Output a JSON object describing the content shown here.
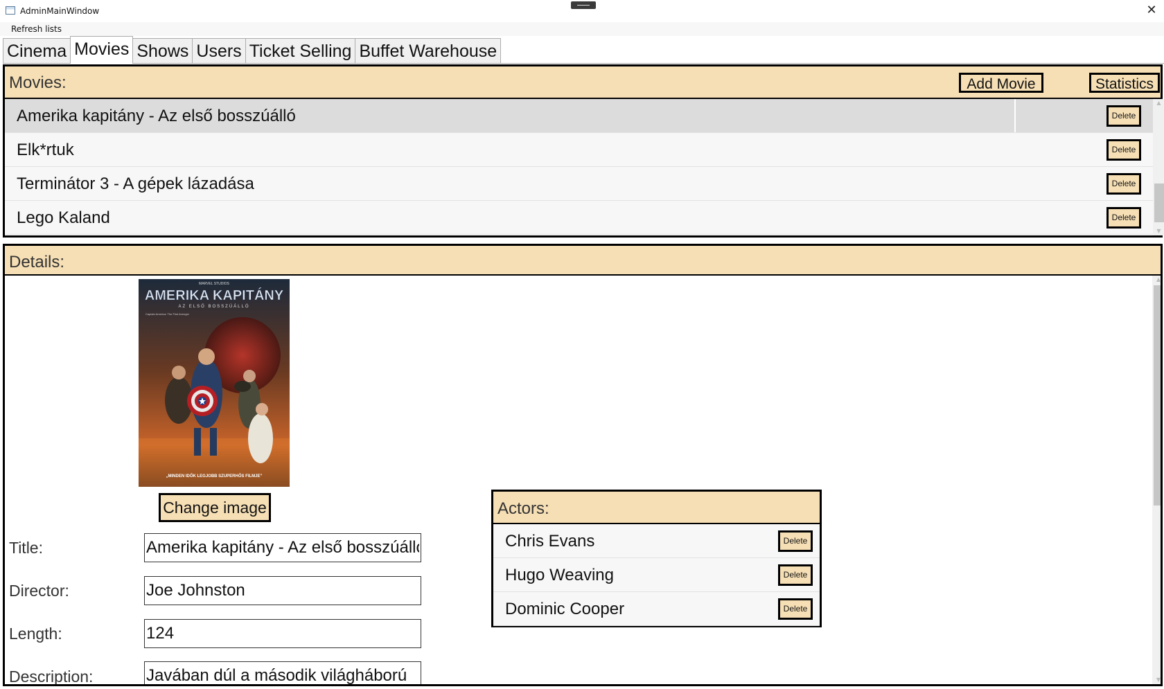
{
  "window": {
    "title": "AdminMainWindow",
    "close_glyph": "✕"
  },
  "menu": {
    "refresh": "Refresh lists"
  },
  "tabs": [
    "Cinema",
    "Movies",
    "Shows",
    "Users",
    "Ticket Selling",
    "Buffet Warehouse"
  ],
  "active_tab": "Movies",
  "movies": {
    "header": "Movies:",
    "add_label": "Add Movie",
    "stats_label": "Statistics",
    "delete_label": "Delete",
    "items": [
      "Amerika kapitány - Az első bosszúálló",
      "Elk*rtuk",
      "Terminátor 3 - A gépek lázadása",
      "Lego Kaland"
    ],
    "selected_index": 0
  },
  "details": {
    "header": "Details:",
    "change_image_label": "Change image",
    "poster": {
      "studio": "MARVEL STUDIOS",
      "title": "AMERIKA KAPITÁNY",
      "subtitle": "AZ ELSŐ BOSSZÚÁLLÓ",
      "small": "Captain America: The First Avenger",
      "tagline": "„MINDEN IDŐK LEGJOBB SZUPERHŐS FILMJE”"
    },
    "title_label": "Title:",
    "title_value": "Amerika kapitány - Az első bosszúálló",
    "director_label": "Director:",
    "director_value": "Joe Johnston",
    "length_label": "Length:",
    "length_value": "124",
    "description_label": "Description:",
    "description_value": "Javában dúl a második világháború"
  },
  "actors": {
    "header": "Actors:",
    "delete_label": "Delete",
    "items": [
      "Chris Evans",
      "Hugo Weaving",
      "Dominic Cooper"
    ]
  },
  "colors": {
    "accent": "#f6dfb5",
    "border": "#000000",
    "selected_row": "#dcdcdc"
  },
  "icons": {
    "window": "app-window-icon",
    "close": "close-icon"
  }
}
